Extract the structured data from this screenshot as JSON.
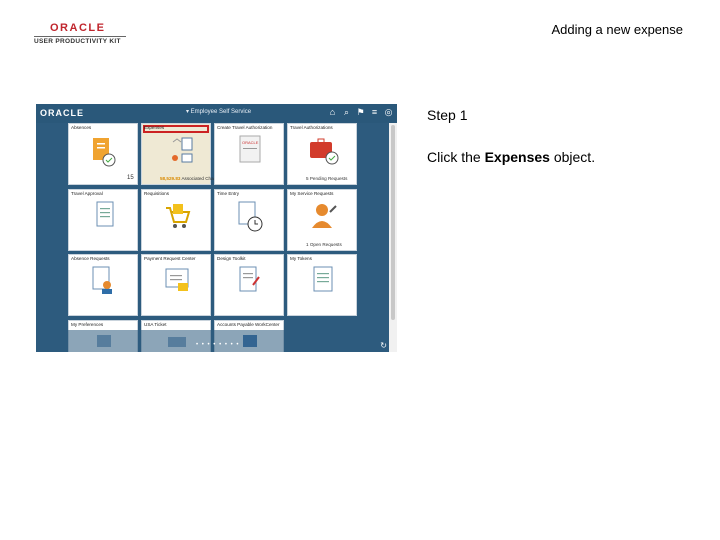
{
  "header": {
    "logo_brand": "ORACLE",
    "logo_product": "USER PRODUCTIVITY KIT",
    "doc_title": "Adding a new expense"
  },
  "screenshot": {
    "brand": "ORACLE",
    "homepage_title": "▾ Employee Self Service",
    "top_icons": [
      "home-icon",
      "search-icon",
      "flag-icon",
      "menu-icon",
      "compass-icon"
    ],
    "tiles": [
      {
        "label": "Absences",
        "extra": "15",
        "selected": false
      },
      {
        "label": "Expenses",
        "extra": "58,529.83 Associated Charges",
        "amount": "58,529.83",
        "extra_text": "Associated Charges",
        "selected": true
      },
      {
        "label": "Create Travel Authorization",
        "extra": "",
        "selected": false
      },
      {
        "label": "Travel Authorizations",
        "extra": "5 Pending Requests",
        "selected": false
      },
      {
        "label": "Travel Approval",
        "extra": "",
        "selected": false
      },
      {
        "label": "Requisitions",
        "extra": "",
        "selected": false
      },
      {
        "label": "Time Entry",
        "extra": "",
        "selected": false
      },
      {
        "label": "My Service Requests",
        "extra": "1 Open Requests",
        "selected": false
      },
      {
        "label": "Absence Requests",
        "extra": "",
        "selected": false
      },
      {
        "label": "Payment Request Center",
        "extra": "",
        "selected": false
      },
      {
        "label": "Design Toolkit",
        "extra": "",
        "selected": false
      },
      {
        "label": "My Tokens",
        "extra": "",
        "selected": false
      },
      {
        "label": "My Preferences",
        "extra": "",
        "selected": false
      },
      {
        "label": "USA Ticket",
        "extra": "",
        "selected": false
      },
      {
        "label": "Accounts Payable WorkCenter",
        "extra": "",
        "selected": false
      }
    ]
  },
  "step": {
    "title": "Step 1",
    "text_before": "Click the ",
    "text_bold": "Expenses",
    "text_after": " object."
  }
}
